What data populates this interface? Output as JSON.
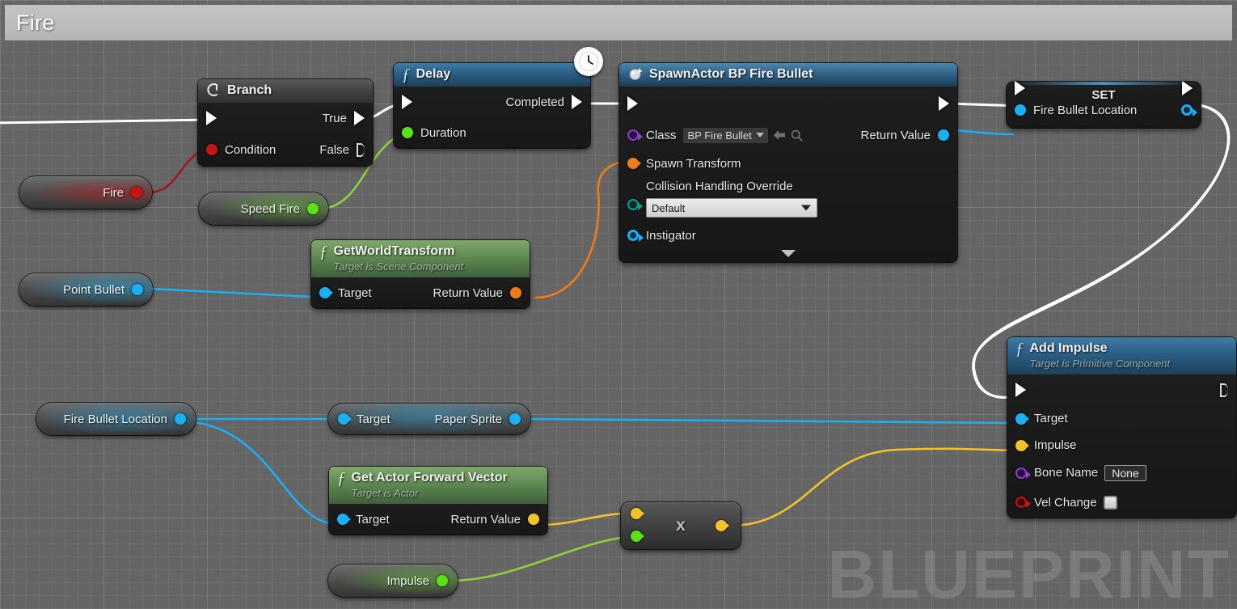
{
  "graph": {
    "title": "Fire",
    "watermark": "BLUEPRINT"
  },
  "nodes": {
    "branch": {
      "title": "Branch",
      "icon": "branch-icon",
      "pins": {
        "exec_in": "",
        "condition": "Condition",
        "true": "True",
        "false": "False"
      }
    },
    "delay": {
      "title": "Delay",
      "icon": "function-icon",
      "badge": "clock-icon",
      "pins": {
        "completed": "Completed",
        "duration": "Duration"
      }
    },
    "spawn_actor": {
      "title": "SpawnActor BP Fire Bullet",
      "icon": "spawn-actor-icon",
      "pins": {
        "class": "Class",
        "class_value": "BP Fire Bullet",
        "spawn_transform": "Spawn Transform",
        "collision_handling_override": "Collision Handling Override",
        "collision_value": "Default",
        "instigator": "Instigator",
        "return_value": "Return Value"
      }
    },
    "set_fire_bullet_location": {
      "title": "SET",
      "pins": {
        "variable": "Fire Bullet Location"
      }
    },
    "get_world_transform": {
      "title": "GetWorldTransform",
      "subtitle": "Target is Scene Component",
      "icon": "function-icon",
      "pins": {
        "target": "Target",
        "return_value": "Return Value"
      }
    },
    "add_impulse": {
      "title": "Add Impulse",
      "subtitle": "Target is Primitive Component",
      "icon": "function-icon",
      "pins": {
        "target": "Target",
        "impulse": "Impulse",
        "bone_name": "Bone Name",
        "bone_name_value": "None",
        "vel_change": "Vel Change",
        "vel_change_checked": false
      }
    },
    "get_actor_forward_vector": {
      "title": "Get Actor Forward Vector",
      "subtitle": "Target is Actor",
      "icon": "function-icon",
      "pins": {
        "target": "Target",
        "return_value": "Return Value"
      }
    },
    "paper_sprite": {
      "pins": {
        "target": "Target",
        "output": "Paper Sprite"
      }
    },
    "multiply": {
      "operator": "x"
    }
  },
  "variables": {
    "fire": "Fire",
    "speed_fire": "Speed Fire",
    "point_bullet": "Point Bullet",
    "fire_bullet_location": "Fire Bullet Location",
    "impulse": "Impulse"
  },
  "colors": {
    "exec_wire": "#ffffff",
    "bool_wire": "#a01818",
    "float_wire": "#8ed13e",
    "vector_wire": "#f2c229",
    "transform_wire": "#f07c17",
    "object_wire": "#19b0f5",
    "node_header_blue": "#2b5e85",
    "node_header_green": "#5f8a52",
    "canvas_bg": "#656565"
  }
}
